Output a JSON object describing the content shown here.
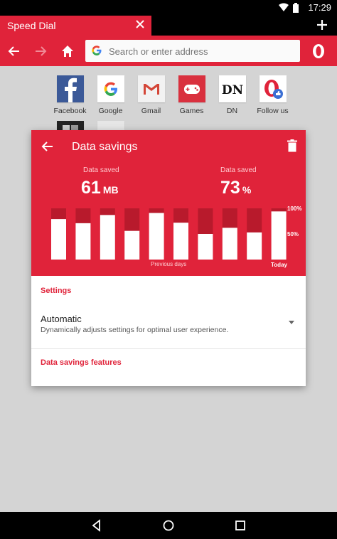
{
  "status": {
    "time": "17:29"
  },
  "tab": {
    "title": "Speed Dial"
  },
  "address_bar": {
    "placeholder": "Search or enter address"
  },
  "speed_dial": [
    {
      "label": "Facebook",
      "icon": "facebook-icon"
    },
    {
      "label": "Google",
      "icon": "google-icon"
    },
    {
      "label": "Gmail",
      "icon": "gmail-icon"
    },
    {
      "label": "Games",
      "icon": "games-icon"
    },
    {
      "label": "DN",
      "icon": "dn-icon"
    },
    {
      "label": "Follow us",
      "icon": "opera-follow-icon"
    }
  ],
  "dialog": {
    "title": "Data savings",
    "stat1": {
      "label": "Data saved",
      "value": "61",
      "unit": "MB"
    },
    "stat2": {
      "label": "Data saved",
      "value": "73",
      "unit": "%"
    },
    "chart": {
      "y_label_top": "100%",
      "y_label_mid": "50%",
      "x_label_previous": "Previous days",
      "x_label_today": "Today"
    },
    "settings_heading": "Settings",
    "setting_name": "Automatic",
    "setting_desc": "Dynamically adjusts settings for optimal user experience.",
    "features_heading": "Data savings features"
  },
  "colors": {
    "brand_red": "#e0233a",
    "dark_red": "#b81a2c"
  },
  "chart_data": {
    "type": "bar",
    "categories": [
      "",
      "",
      "",
      "",
      "",
      "",
      "",
      "",
      "",
      "Today"
    ],
    "series": [
      {
        "values": [
          79,
          71,
          87,
          56,
          91,
          72,
          50,
          62,
          53,
          94
        ]
      }
    ],
    "ylim": [
      0,
      100
    ]
  }
}
